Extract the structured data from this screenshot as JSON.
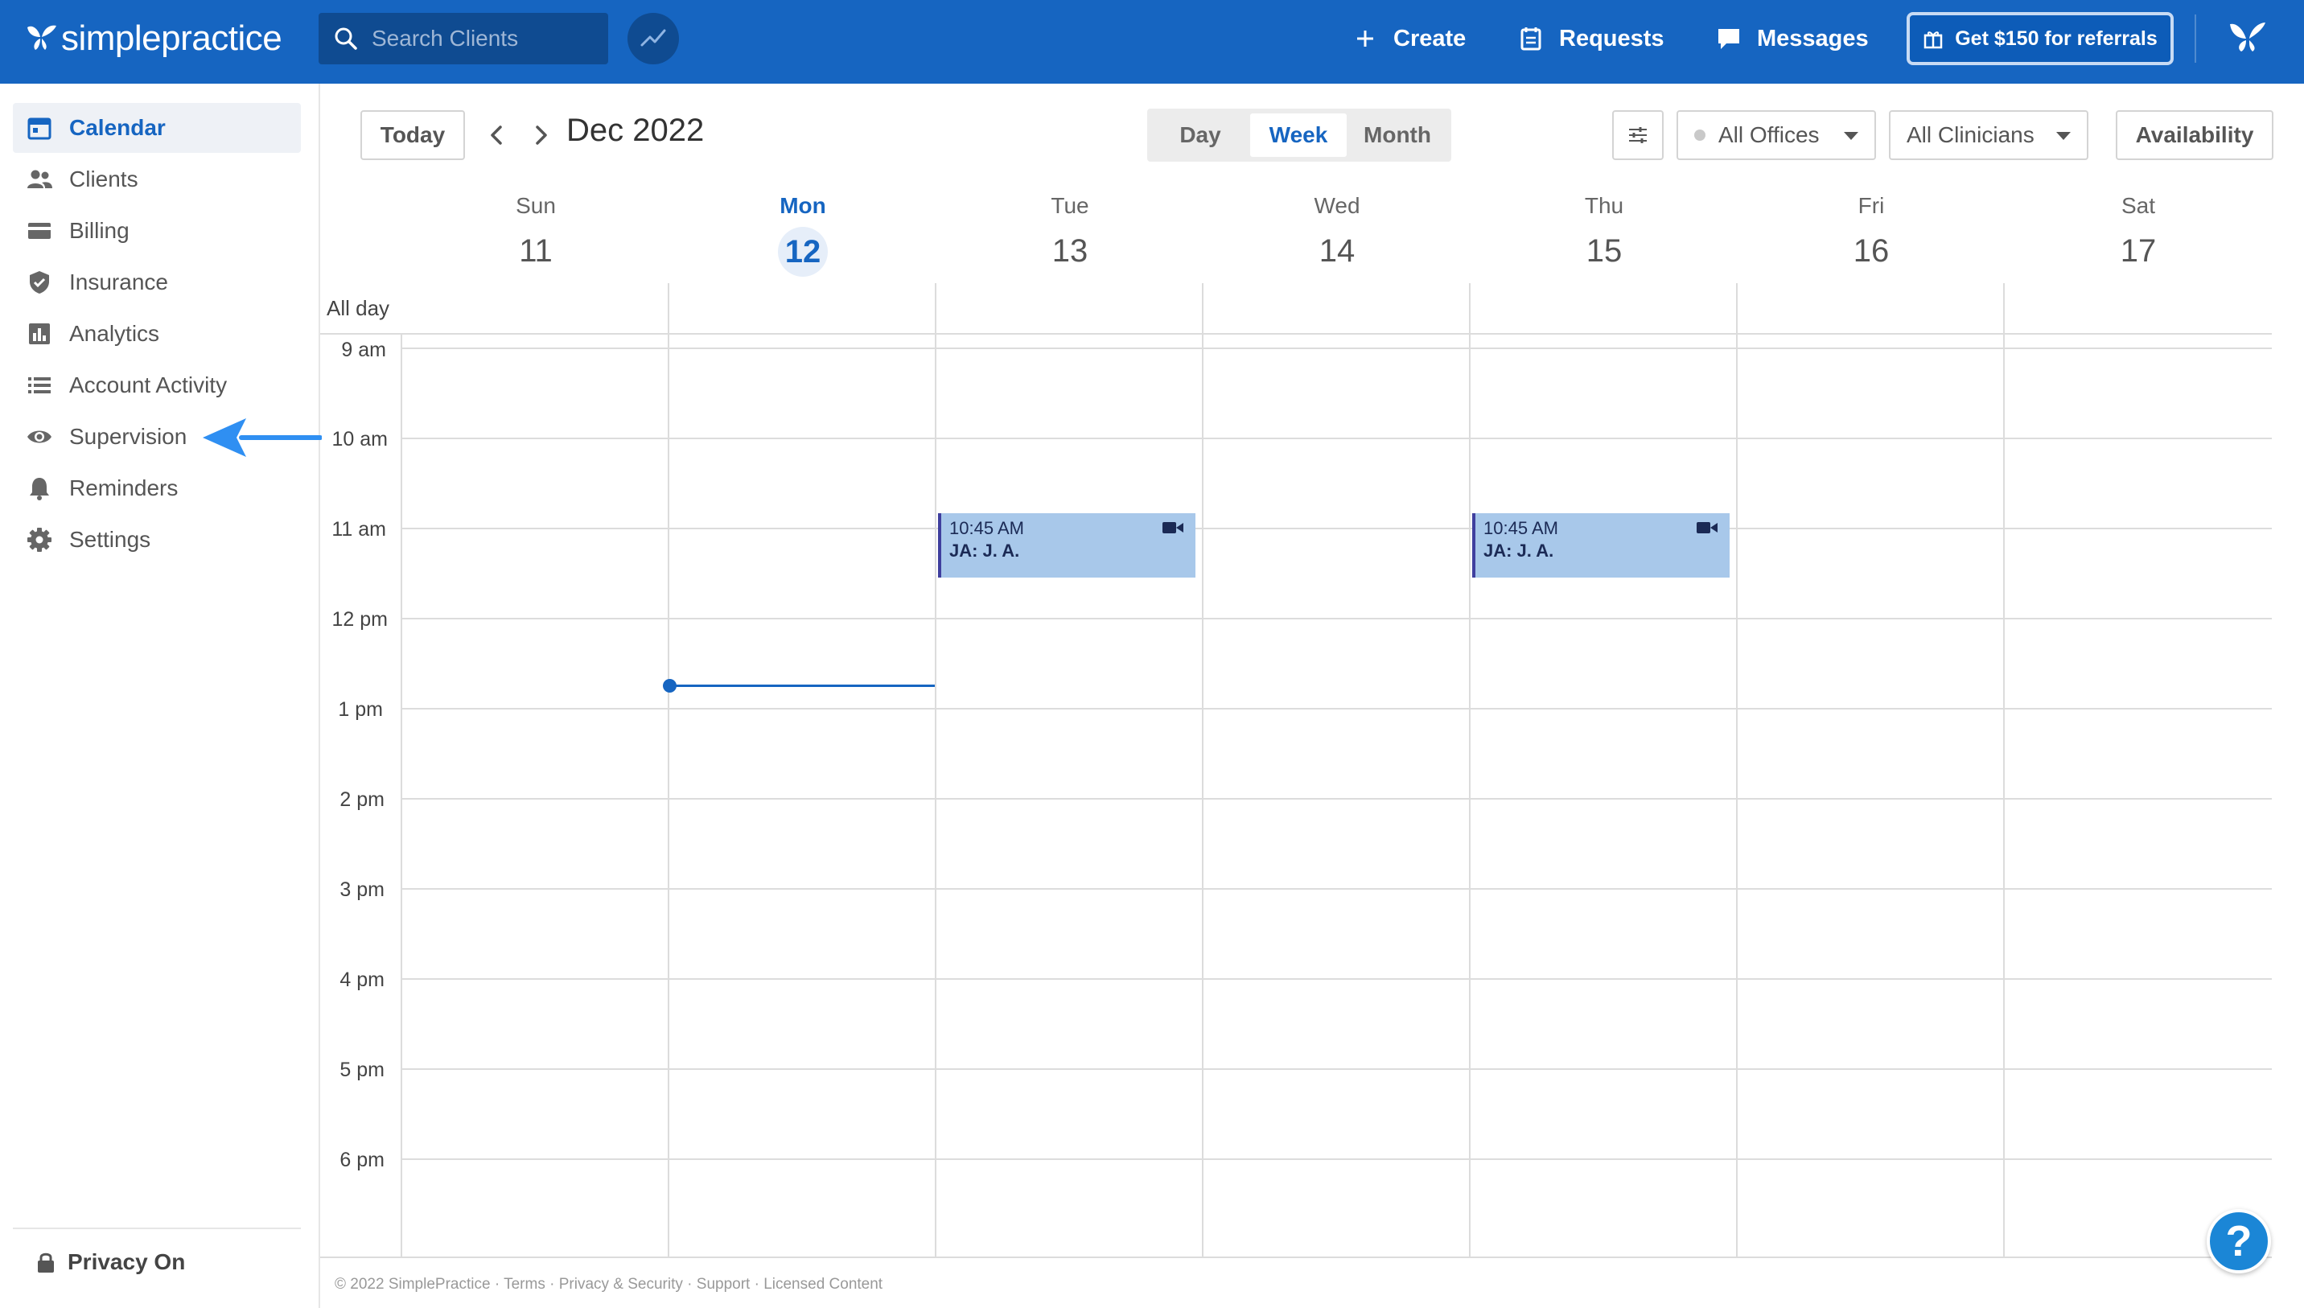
{
  "brand": {
    "name": "simplepractice",
    "accent": "#1665c1"
  },
  "search": {
    "placeholder": "Search Clients"
  },
  "topnav": {
    "create": "Create",
    "requests": "Requests",
    "messages": "Messages",
    "referral": "Get $150 for referrals"
  },
  "sidebar": {
    "items": [
      {
        "label": "Calendar",
        "icon": "calendar-icon"
      },
      {
        "label": "Clients",
        "icon": "clients-icon"
      },
      {
        "label": "Billing",
        "icon": "billing-icon"
      },
      {
        "label": "Insurance",
        "icon": "insurance-icon"
      },
      {
        "label": "Analytics",
        "icon": "analytics-icon"
      },
      {
        "label": "Account Activity",
        "icon": "list-icon"
      },
      {
        "label": "Supervision",
        "icon": "eye-icon"
      },
      {
        "label": "Reminders",
        "icon": "bell-icon"
      },
      {
        "label": "Settings",
        "icon": "gear-icon"
      }
    ],
    "privacy": "Privacy On"
  },
  "toolbar": {
    "today": "Today",
    "title": "Dec 2022",
    "views": [
      "Day",
      "Week",
      "Month"
    ],
    "selected_view": "Week",
    "offices": "All Offices",
    "clinicians": "All Clinicians",
    "availability": "Availability"
  },
  "days": [
    {
      "name": "Sun",
      "num": "11"
    },
    {
      "name": "Mon",
      "num": "12"
    },
    {
      "name": "Tue",
      "num": "13"
    },
    {
      "name": "Wed",
      "num": "14"
    },
    {
      "name": "Thu",
      "num": "15"
    },
    {
      "name": "Fri",
      "num": "16"
    },
    {
      "name": "Sat",
      "num": "17"
    }
  ],
  "allday_label": "All day",
  "hours": [
    "9 am",
    "10 am",
    "11 am",
    "12 pm",
    "1 pm",
    "2 pm",
    "3 pm",
    "4 pm",
    "5 pm",
    "6 pm"
  ],
  "events": [
    {
      "day": "Tue",
      "time": "10:45 AM",
      "title": "JA: J. A."
    },
    {
      "day": "Thu",
      "time": "10:45 AM",
      "title": "JA: J. A."
    }
  ],
  "footer": {
    "copyright": "© 2022 SimplePractice",
    "links": [
      "Terms",
      "Privacy & Security",
      "Support",
      "Licensed Content"
    ]
  },
  "help": "?"
}
